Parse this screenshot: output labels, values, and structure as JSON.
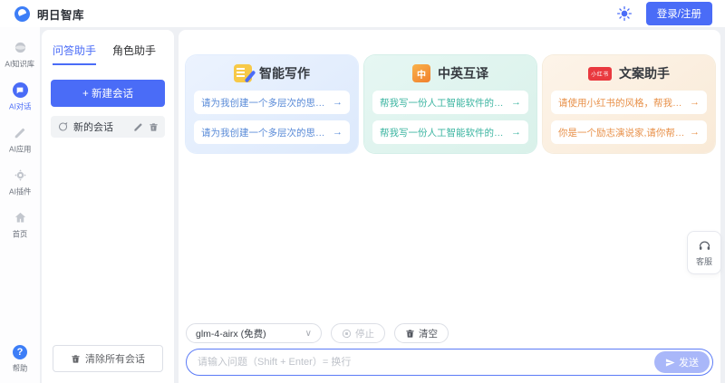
{
  "header": {
    "title": "明日智库",
    "login_label": "登录/注册"
  },
  "rail": {
    "items": [
      {
        "label": "AI知识库"
      },
      {
        "label": "AI对话"
      },
      {
        "label": "AI应用"
      },
      {
        "label": "AI插件"
      },
      {
        "label": "首页"
      }
    ],
    "help_label": "帮助"
  },
  "sidebar": {
    "tabs": [
      {
        "label": "问答助手"
      },
      {
        "label": "角色助手"
      }
    ],
    "new_chat_label": "+ 新建会话",
    "conversation_title": "新的会话",
    "clear_all_label": "清除所有会话"
  },
  "cards": [
    {
      "title": "智能写作",
      "accent": "#5a8bd8",
      "prompts": [
        "请为我创建一个多层次的思维导图，主题是...",
        "请为我创建一个多层次的思维导图，主题是..."
      ]
    },
    {
      "title": "中英互译",
      "accent": "#3cb5a1",
      "icon_text": "中",
      "prompts": [
        "帮我写一份人工智能软件的产品经理的工作...",
        "帮我写一份人工智能软件的产品经理的工作..."
      ]
    },
    {
      "title": "文案助手",
      "accent": "#e8914a",
      "icon_text": "小红书",
      "prompts": [
        "请使用小红书的风格，帮我为小红书账号编...",
        "你是一个励志演说家,请你帮我用小红书的..."
      ]
    }
  ],
  "composer": {
    "model_value": "glm-4-airx (免费)",
    "stop_label": "停止",
    "clear_label": "清空",
    "placeholder": "请输入问题（Shift + Enter）= 换行",
    "send_label": "发送"
  },
  "support": {
    "label": "客服"
  },
  "icons": {
    "arrow": "→",
    "chevron": "∨"
  },
  "colors": {
    "primary": "#4a6cf7",
    "card_blue_text": "#5a8bd8",
    "card_teal_text": "#3cb5a1",
    "card_orange_text": "#e8914a",
    "send_button": "#a9b7f9"
  }
}
